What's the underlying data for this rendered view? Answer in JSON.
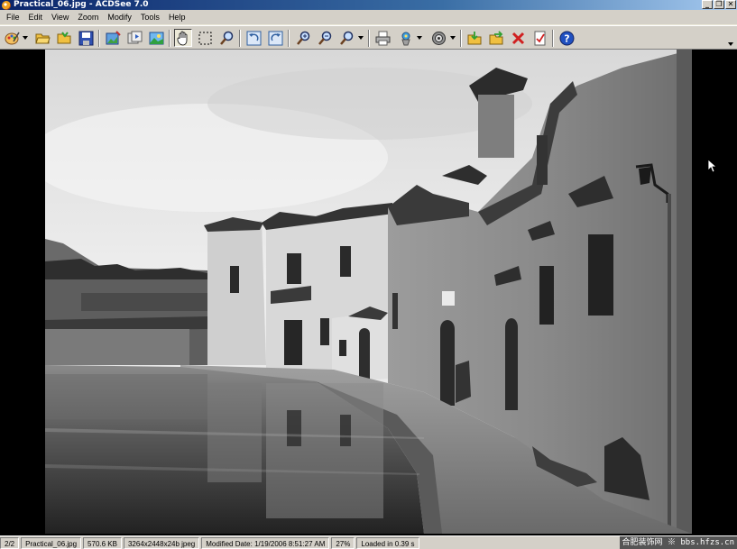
{
  "window": {
    "title": "Practical_06.jpg - ACDSee 7.0"
  },
  "menu": [
    "File",
    "Edit",
    "View",
    "Zoom",
    "Modify",
    "Tools",
    "Help"
  ],
  "status": {
    "index": "2/2",
    "filename": "Practical_06.jpg",
    "filesize": "570.6 KB",
    "dimensions": "3264x2448x24b jpeg",
    "modified": "Modified Date: 1/19/2006 8:51:27 AM",
    "zoom": "27%",
    "load_time": "Loaded in 0.39 s"
  },
  "watermark": "合肥装饰网 ※ bbs.hfzs.cn",
  "toolbar_icons": [
    "acquire-icon",
    "browse-icon",
    "open-folder-icon",
    "save-icon",
    "edit-image-icon",
    "slideshow-icon",
    "photo-icon",
    "hand-tool-icon",
    "select-tool-icon",
    "magnifier-icon",
    "rotate-left-icon",
    "rotate-right-icon",
    "zoom-in-icon",
    "zoom-out-icon",
    "zoom-options-icon",
    "print-icon",
    "wallpaper-icon",
    "filter-icon",
    "copy-to-icon",
    "move-to-icon",
    "delete-icon",
    "properties-icon",
    "help-icon"
  ],
  "colors": {
    "titlebar": "#0a246a",
    "chrome": "#d4d0c8",
    "viewer_bg": "#000000"
  }
}
